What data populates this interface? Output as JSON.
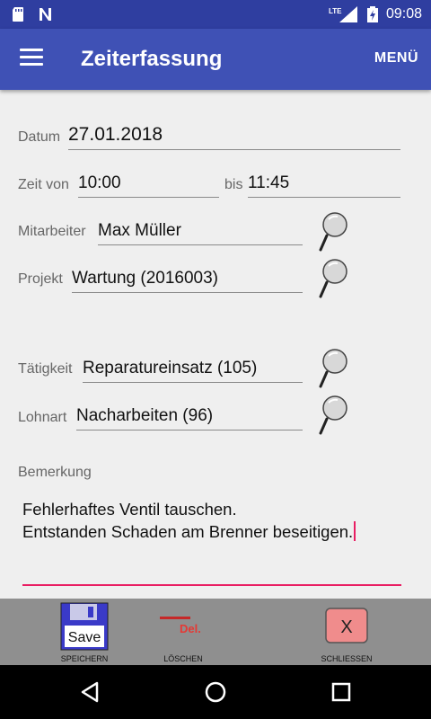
{
  "status": {
    "network": "LTE",
    "time": "09:08"
  },
  "appbar": {
    "title": "Zeiterfassung",
    "menu_label": "MENÜ"
  },
  "form": {
    "datum_label": "Datum",
    "datum_value": "27.01.2018",
    "zeit_von_label": "Zeit von",
    "zeit_von_value": "10:00",
    "bis_label": "bis",
    "bis_value": "11:45",
    "mitarbeiter_label": "Mitarbeiter",
    "mitarbeiter_value": "Max Müller",
    "projekt_label": "Projekt",
    "projekt_value": "Wartung (2016003)",
    "taetigkeit_label": "Tätigkeit",
    "taetigkeit_value": "Reparatureinsatz (105)",
    "lohnart_label": "Lohnart",
    "lohnart_value": "Nacharbeiten (96)",
    "bemerkung_label": "Bemerkung",
    "bemerkung_line1": "Fehlerhaftes Ventil tauschen.",
    "bemerkung_line2": "Entstanden Schaden am Brenner beseitigen."
  },
  "toolbar": {
    "save_icon_text": "Save",
    "save_label": "SPEICHERN",
    "delete_icon_text": "Del.",
    "delete_label": "LÖSCHEN",
    "close_icon_text": "X",
    "close_label": "SCHLIESSEN"
  },
  "colors": {
    "primary": "#3f51b5",
    "primary_dark": "#2f3ea0",
    "accent": "#e91e63",
    "toolbar": "#8f8f8f"
  }
}
